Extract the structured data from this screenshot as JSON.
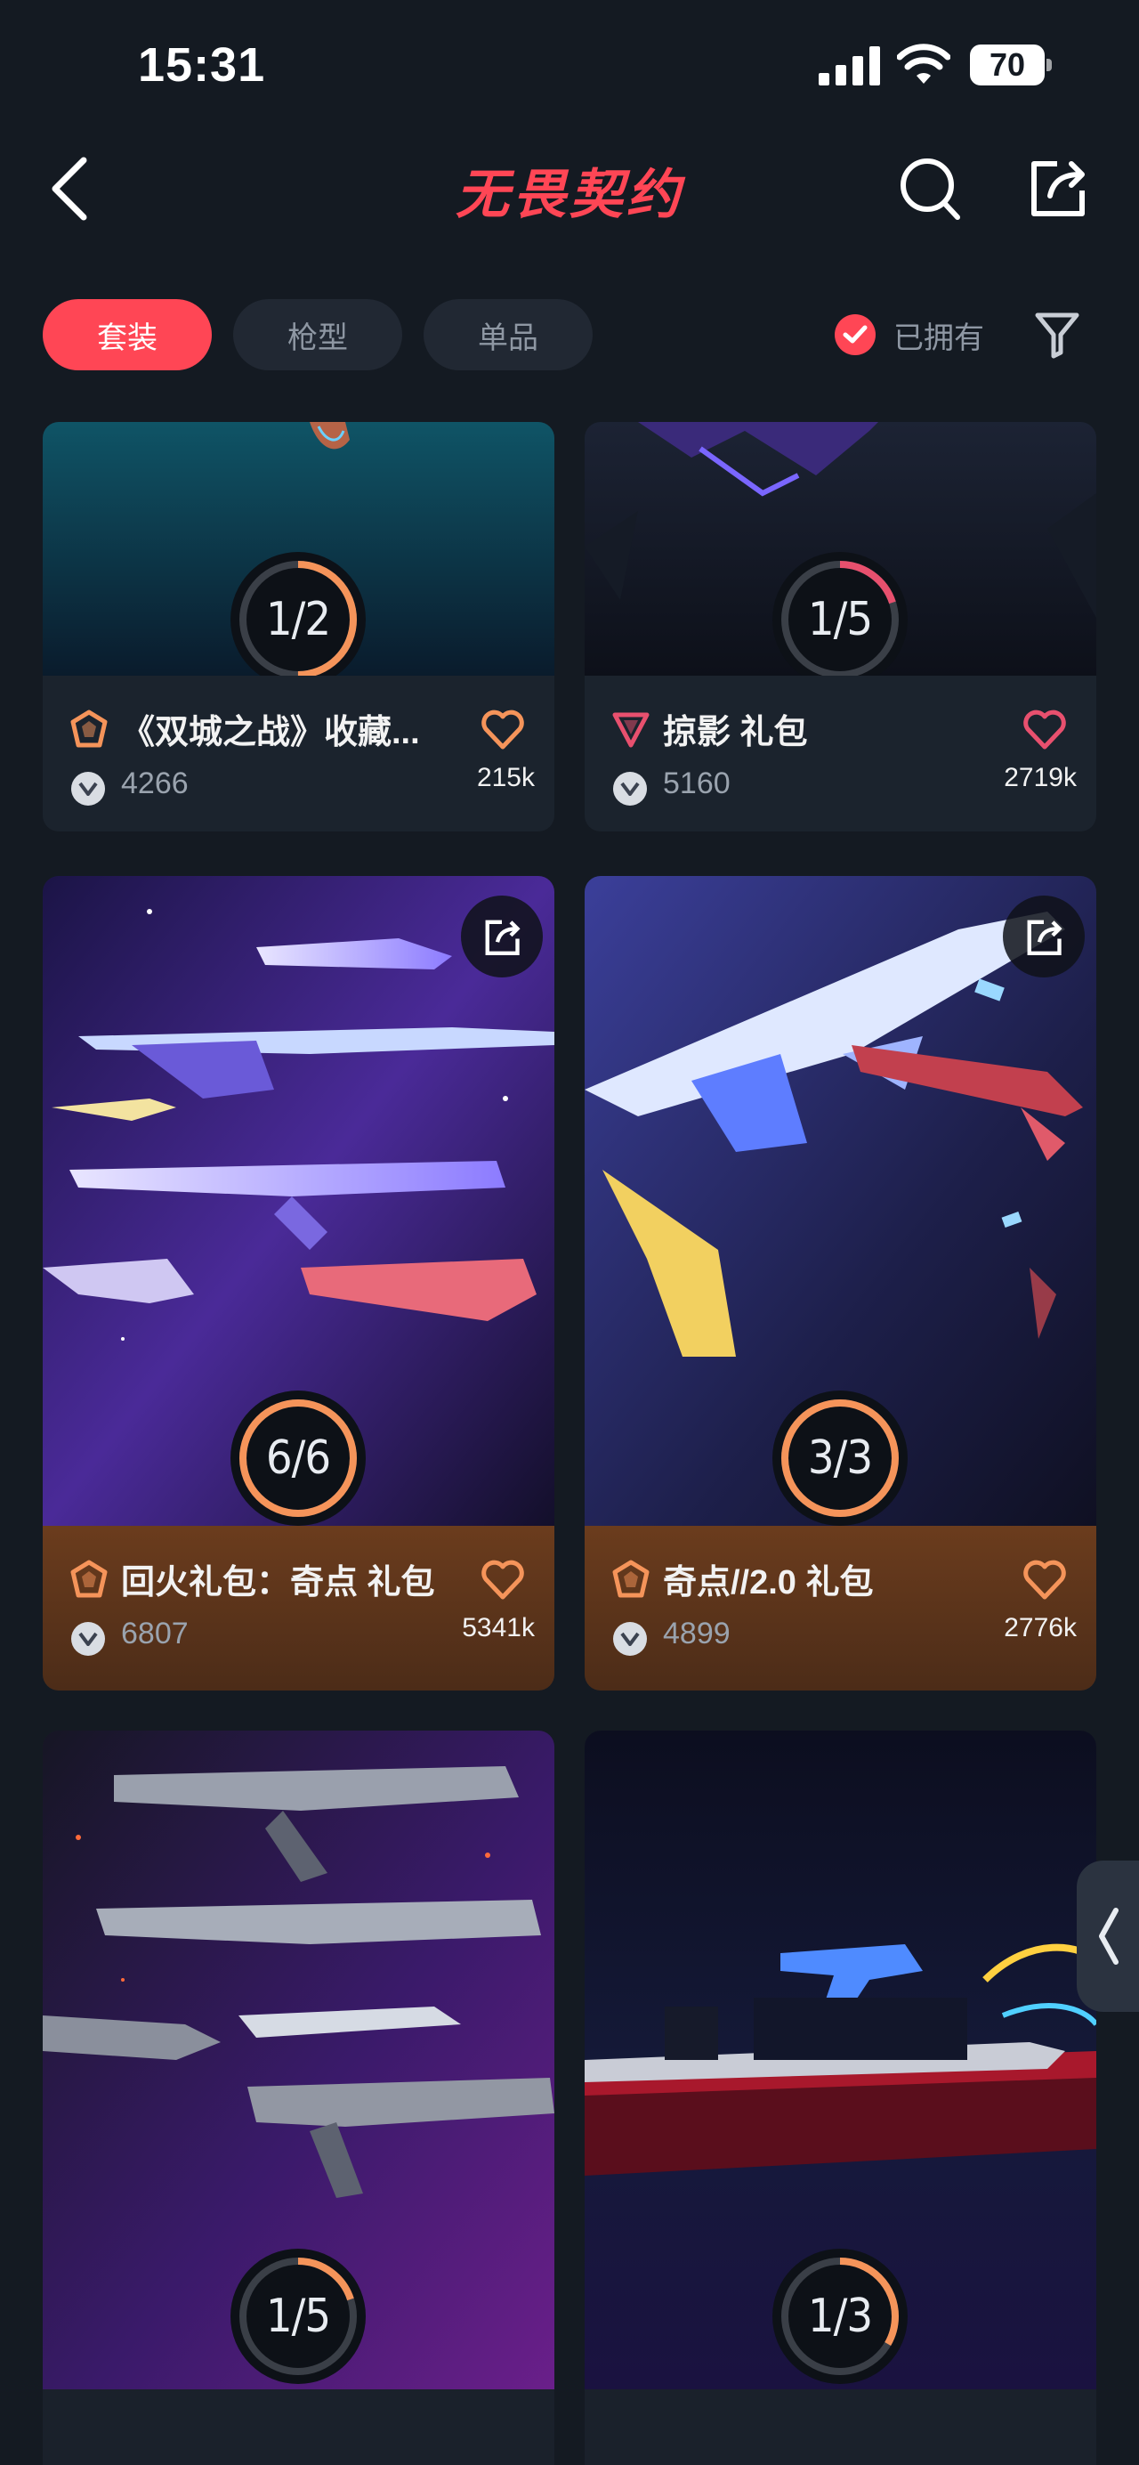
{
  "status_bar": {
    "time": "15:31",
    "battery": "70"
  },
  "header": {
    "title": "无畏契约"
  },
  "filters": {
    "tabs": [
      {
        "label": "套装",
        "active": true
      },
      {
        "label": "枪型",
        "active": false
      },
      {
        "label": "单品",
        "active": false
      }
    ],
    "owned_label": "已拥有"
  },
  "colors": {
    "accent": "#ff4655",
    "background": "#141a22",
    "gold_panel": "#6b3c1d",
    "progress_orange": "#f5945a",
    "progress_pink": "#e8506e"
  },
  "cards": [
    {
      "name": "《双城之战》收藏...",
      "price": "4266",
      "likes": "215k",
      "owned": 1,
      "total": 2,
      "tier_icon": "premium-tier-icon",
      "heart_color": "#f5945a"
    },
    {
      "name": "掠影 礼包",
      "price": "5160",
      "likes": "2719k",
      "owned": 1,
      "total": 5,
      "tier_icon": "deluxe-tier-icon",
      "heart_color": "#e8506e"
    },
    {
      "name": "回火礼包：奇点 礼包",
      "price": "6807",
      "likes": "5341k",
      "owned": 6,
      "total": 6,
      "tier_icon": "premium-tier-icon",
      "heart_color": "#f5945a"
    },
    {
      "name": "奇点//2.0 礼包",
      "price": "4899",
      "likes": "2776k",
      "owned": 3,
      "total": 3,
      "tier_icon": "premium-tier-icon",
      "heart_color": "#f5945a"
    },
    {
      "name": "",
      "price": "",
      "likes": "",
      "owned": 1,
      "total": 5
    },
    {
      "name": "",
      "price": "",
      "likes": "",
      "owned": 1,
      "total": 3
    }
  ]
}
